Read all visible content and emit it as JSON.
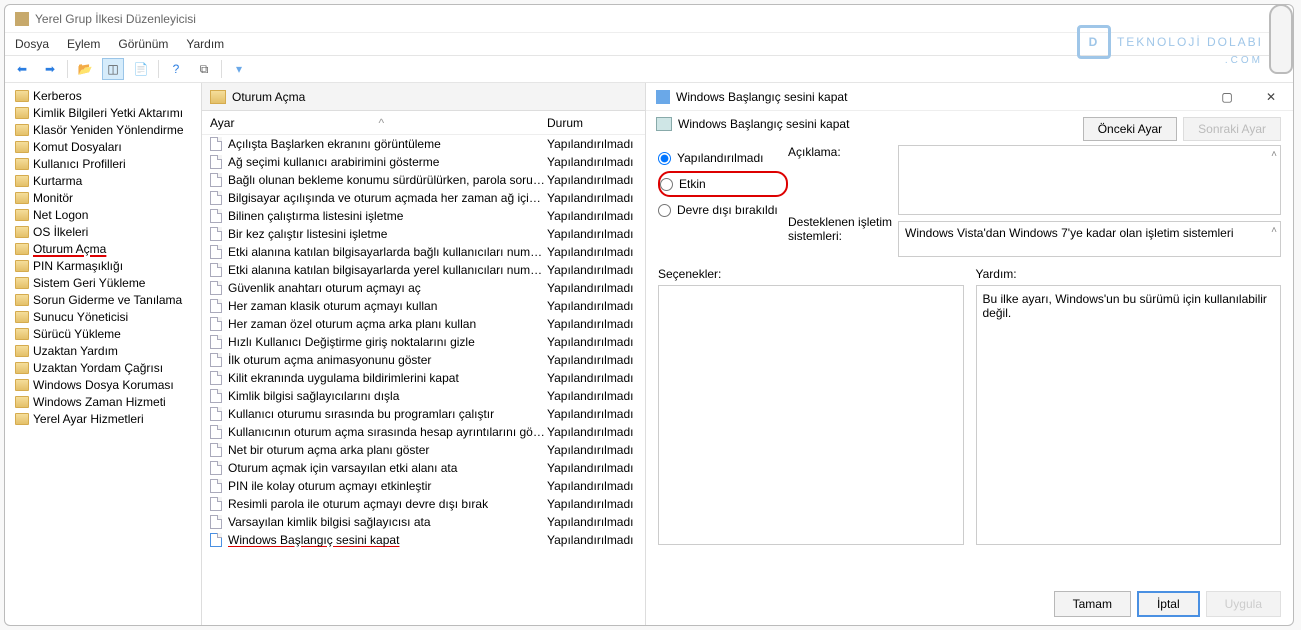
{
  "window_title": "Yerel Grup İlkesi Düzenleyicisi",
  "menubar": [
    "Dosya",
    "Eylem",
    "Görünüm",
    "Yardım"
  ],
  "tree": [
    {
      "label": "Kerberos"
    },
    {
      "label": "Kimlik Bilgileri Yetki Aktarımı"
    },
    {
      "label": "Klasör Yeniden Yönlendirme"
    },
    {
      "label": "Komut Dosyaları"
    },
    {
      "label": "Kullanıcı Profilleri"
    },
    {
      "label": "Kurtarma"
    },
    {
      "label": "Monitör"
    },
    {
      "label": "Net Logon"
    },
    {
      "label": "OS İlkeleri"
    },
    {
      "label": "Oturum Açma",
      "highlight": true
    },
    {
      "label": "PIN Karmaşıklığı"
    },
    {
      "label": "Sistem Geri Yükleme"
    },
    {
      "label": "Sorun Giderme ve Tanılama"
    },
    {
      "label": "Sunucu Yöneticisi"
    },
    {
      "label": "Sürücü Yükleme"
    },
    {
      "label": "Uzaktan Yardım"
    },
    {
      "label": "Uzaktan Yordam Çağrısı"
    },
    {
      "label": "Windows Dosya Koruması"
    },
    {
      "label": "Windows Zaman Hizmeti"
    },
    {
      "label": "Yerel Ayar Hizmetleri"
    }
  ],
  "list_header": "Oturum Açma",
  "list_cols": {
    "c1": "Ayar",
    "c2": "Durum"
  },
  "list": [
    {
      "label": "Açılışta Başlarken ekranını görüntüleme",
      "state": "Yapılandırılmadı"
    },
    {
      "label": "Ağ seçimi kullanıcı arabirimini gösterme",
      "state": "Yapılandırılmadı"
    },
    {
      "label": "Bağlı olunan bekleme konumu sürdürülürken, parola sorul…",
      "state": "Yapılandırılmadı"
    },
    {
      "label": "Bilgisayar açılışında ve oturum açmada her zaman ağ için be…",
      "state": "Yapılandırılmadı"
    },
    {
      "label": "Bilinen çalıştırma listesini işletme",
      "state": "Yapılandırılmadı"
    },
    {
      "label": "Bir kez çalıştır listesini işletme",
      "state": "Yapılandırılmadı"
    },
    {
      "label": "Etki alanına katılan bilgisayarlarda bağlı kullanıcıları numaral…",
      "state": "Yapılandırılmadı"
    },
    {
      "label": "Etki alanına katılan bilgisayarlarda yerel kullanıcıları numaral…",
      "state": "Yapılandırılmadı"
    },
    {
      "label": "Güvenlik anahtarı oturum açmayı aç",
      "state": "Yapılandırılmadı"
    },
    {
      "label": "Her zaman klasik oturum açmayı kullan",
      "state": "Yapılandırılmadı"
    },
    {
      "label": "Her zaman özel oturum açma arka planı kullan",
      "state": "Yapılandırılmadı"
    },
    {
      "label": "Hızlı Kullanıcı Değiştirme giriş noktalarını gizle",
      "state": "Yapılandırılmadı"
    },
    {
      "label": "İlk oturum açma animasyonunu göster",
      "state": "Yapılandırılmadı"
    },
    {
      "label": "Kilit ekranında uygulama bildirimlerini kapat",
      "state": "Yapılandırılmadı"
    },
    {
      "label": "Kimlik bilgisi sağlayıcılarını dışla",
      "state": "Yapılandırılmadı"
    },
    {
      "label": "Kullanıcı oturumu sırasında bu programları çalıştır",
      "state": "Yapılandırılmadı"
    },
    {
      "label": "Kullanıcının oturum açma sırasında hesap ayrıntılarını göste…",
      "state": "Yapılandırılmadı"
    },
    {
      "label": "Net bir oturum açma arka planı göster",
      "state": "Yapılandırılmadı"
    },
    {
      "label": "Oturum açmak için varsayılan etki alanı ata",
      "state": "Yapılandırılmadı"
    },
    {
      "label": "PIN ile kolay oturum açmayı etkinleştir",
      "state": "Yapılandırılmadı"
    },
    {
      "label": "Resimli parola ile oturum açmayı devre dışı bırak",
      "state": "Yapılandırılmadı"
    },
    {
      "label": "Varsayılan kimlik bilgisi sağlayıcısı ata",
      "state": "Yapılandırılmadı"
    },
    {
      "label": "Windows Başlangıç sesini kapat",
      "state": "Yapılandırılmadı",
      "highlight": true
    }
  ],
  "dialog": {
    "title": "Windows Başlangıç sesini kapat",
    "subtitle": "Windows Başlangıç sesini kapat",
    "prev": "Önceki Ayar",
    "next": "Sonraki Ayar",
    "radios": {
      "r1": "Yapılandırılmadı",
      "r2": "Etkin",
      "r3": "Devre dışı bırakıldı"
    },
    "labels": {
      "acik": "Açıklama:",
      "dest": "Desteklenen işletim sistemleri:",
      "sec": "Seçenekler:",
      "yard": "Yardım:"
    },
    "os_value": "Windows Vista'dan Windows 7'ye kadar olan işletim sistemleri",
    "help_value": "Bu ilke ayarı, Windows'un bu sürümü için kullanılabilir değil.",
    "buttons": {
      "ok": "Tamam",
      "cancel": "İptal",
      "apply": "Uygula"
    }
  },
  "watermark": {
    "brand": "TEKNOLOJİ DOLABI",
    "sub": ".COM"
  }
}
